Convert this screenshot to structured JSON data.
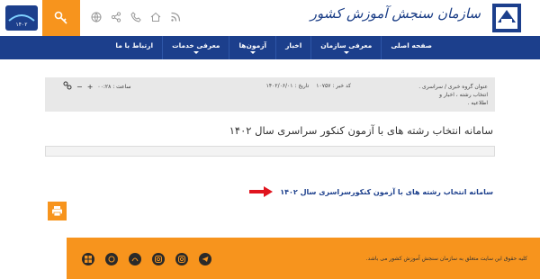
{
  "header": {
    "logo_text": "سازمان سنجش آموزش کشور",
    "icons": [
      "rss-icon",
      "home-icon",
      "phone-icon",
      "share-icon",
      "globe-icon",
      "key-icon"
    ]
  },
  "nav": {
    "items": [
      {
        "label": "صفحه اصلی",
        "dropdown": false
      },
      {
        "label": "معرفی سازمان",
        "dropdown": true
      },
      {
        "label": "اخبار",
        "dropdown": false
      },
      {
        "label": "آزمون‌ها",
        "dropdown": true
      },
      {
        "label": "معرفی خدمات",
        "dropdown": true
      },
      {
        "label": "ارتباط با ما",
        "dropdown": false
      }
    ]
  },
  "info": {
    "group": "عنوان گروه خبری / سراسری .",
    "group_line2": "انتخاب رشته ، اخبار و",
    "group_line3": "اطلاعیه .",
    "news_code": "کد خبر : ۱۰۷۵۷",
    "date": "تاریخ : ۱۴۰۲/۰۶/۰۱",
    "time": "ساعت : ۰۰:۲۸",
    "font_plus": "+",
    "font_minus": "−"
  },
  "main": {
    "title": "سامانه انتخاب رشته های با آزمون کنکور سراسری سال ۱۴۰۲",
    "system_link": "سامانه انتخاب رشته های با آزمون کنکورسراسری سال ۱۴۰۲"
  },
  "footer": {
    "copyright": "کلیه حقوق این سایت متعلق به سازمان سنجش آموزش کشور می باشد.",
    "socials": [
      "windows-icon",
      "bale-icon",
      "eitaa-icon",
      "instagram-icon",
      "instagram-icon",
      "telegram-icon"
    ]
  },
  "colors": {
    "brand_blue": "#1c3f8c",
    "accent_orange": "#f7941d"
  }
}
